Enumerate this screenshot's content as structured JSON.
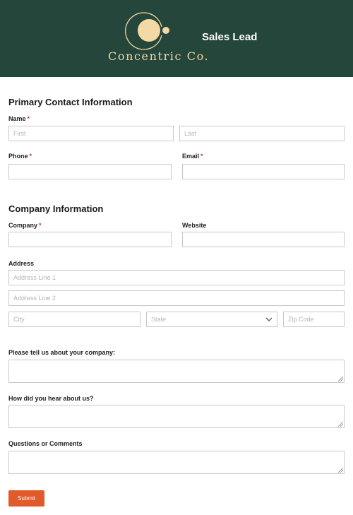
{
  "header": {
    "logo_text": "Concentric Co.",
    "form_title": "Sales Lead"
  },
  "primary_contact": {
    "section_title": "Primary Contact Information",
    "name_label": "Name",
    "first_placeholder": "First",
    "last_placeholder": "Last",
    "phone_label": "Phone",
    "email_label": "Email",
    "required_mark": "*"
  },
  "company_info": {
    "section_title": "Company Information",
    "company_label": "Company",
    "website_label": "Website",
    "address_label": "Address",
    "address1_placeholder": "Address Line 1",
    "address2_placeholder": "Address Line 2",
    "city_placeholder": "City",
    "state_placeholder": "State",
    "zip_placeholder": "Zip Code"
  },
  "questions": {
    "about_label": "Please tell us about your company:",
    "hear_label": "How did you hear about us?",
    "comments_label": "Questions or Comments"
  },
  "submit_label": "Submit",
  "colors": {
    "header_bg": "#25463a",
    "logo_gold": "#f3d9a4",
    "submit_bg": "#e05a2b",
    "required": "#c0392b"
  }
}
